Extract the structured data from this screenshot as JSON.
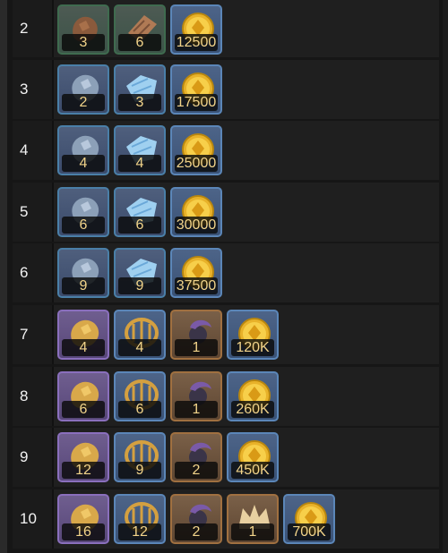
{
  "rows": [
    {
      "level": "2",
      "items": [
        {
          "icon": "copper-ore-icon",
          "rarity": "green",
          "count": "3"
        },
        {
          "icon": "copper-ingot-icon",
          "rarity": "green",
          "count": "6"
        },
        {
          "icon": "gold-coin-icon",
          "rarity": "coin",
          "count": "12500"
        }
      ]
    },
    {
      "level": "3",
      "items": [
        {
          "icon": "silver-ore-icon",
          "rarity": "blue",
          "count": "2"
        },
        {
          "icon": "crystal-icon",
          "rarity": "blue",
          "count": "3"
        },
        {
          "icon": "gold-coin-icon",
          "rarity": "coin",
          "count": "17500"
        }
      ]
    },
    {
      "level": "4",
      "items": [
        {
          "icon": "silver-ore-icon",
          "rarity": "blue",
          "count": "4"
        },
        {
          "icon": "crystal-icon",
          "rarity": "blue",
          "count": "4"
        },
        {
          "icon": "gold-coin-icon",
          "rarity": "coin",
          "count": "25000"
        }
      ]
    },
    {
      "level": "5",
      "items": [
        {
          "icon": "silver-ore-icon",
          "rarity": "blue",
          "count": "6"
        },
        {
          "icon": "crystal-icon",
          "rarity": "blue",
          "count": "6"
        },
        {
          "icon": "gold-coin-icon",
          "rarity": "coin",
          "count": "30000"
        }
      ]
    },
    {
      "level": "6",
      "items": [
        {
          "icon": "silver-ore-icon",
          "rarity": "blue",
          "count": "9"
        },
        {
          "icon": "crystal-icon",
          "rarity": "blue",
          "count": "9"
        },
        {
          "icon": "gold-coin-icon",
          "rarity": "coin",
          "count": "37500"
        }
      ]
    },
    {
      "level": "7",
      "items": [
        {
          "icon": "gold-ore-icon",
          "rarity": "purple",
          "count": "4"
        },
        {
          "icon": "cage-relic-icon",
          "rarity": "coin",
          "count": "4"
        },
        {
          "icon": "dark-orb-icon",
          "rarity": "orange",
          "count": "1"
        },
        {
          "icon": "gold-coin-icon",
          "rarity": "coin",
          "count": "120K"
        }
      ]
    },
    {
      "level": "8",
      "items": [
        {
          "icon": "gold-ore-icon",
          "rarity": "purple",
          "count": "6"
        },
        {
          "icon": "cage-relic-icon",
          "rarity": "coin",
          "count": "6"
        },
        {
          "icon": "dark-orb-icon",
          "rarity": "orange",
          "count": "1"
        },
        {
          "icon": "gold-coin-icon",
          "rarity": "coin",
          "count": "260K"
        }
      ]
    },
    {
      "level": "9",
      "items": [
        {
          "icon": "gold-ore-icon",
          "rarity": "purple",
          "count": "12"
        },
        {
          "icon": "cage-relic-icon",
          "rarity": "coin",
          "count": "9"
        },
        {
          "icon": "dark-orb-icon",
          "rarity": "orange",
          "count": "2"
        },
        {
          "icon": "gold-coin-icon",
          "rarity": "coin",
          "count": "450K"
        }
      ]
    },
    {
      "level": "10",
      "items": [
        {
          "icon": "gold-ore-icon",
          "rarity": "purple",
          "count": "16"
        },
        {
          "icon": "cage-relic-icon",
          "rarity": "coin",
          "count": "12"
        },
        {
          "icon": "dark-orb-icon",
          "rarity": "orange",
          "count": "2"
        },
        {
          "icon": "crown-icon",
          "rarity": "crown",
          "count": "1"
        },
        {
          "icon": "gold-coin-icon",
          "rarity": "coin",
          "count": "700K"
        }
      ]
    }
  ],
  "colors": {
    "count_text": "#f2d48a",
    "level_text": "#f2f2f2",
    "row_bg": "#1f1f1f"
  }
}
